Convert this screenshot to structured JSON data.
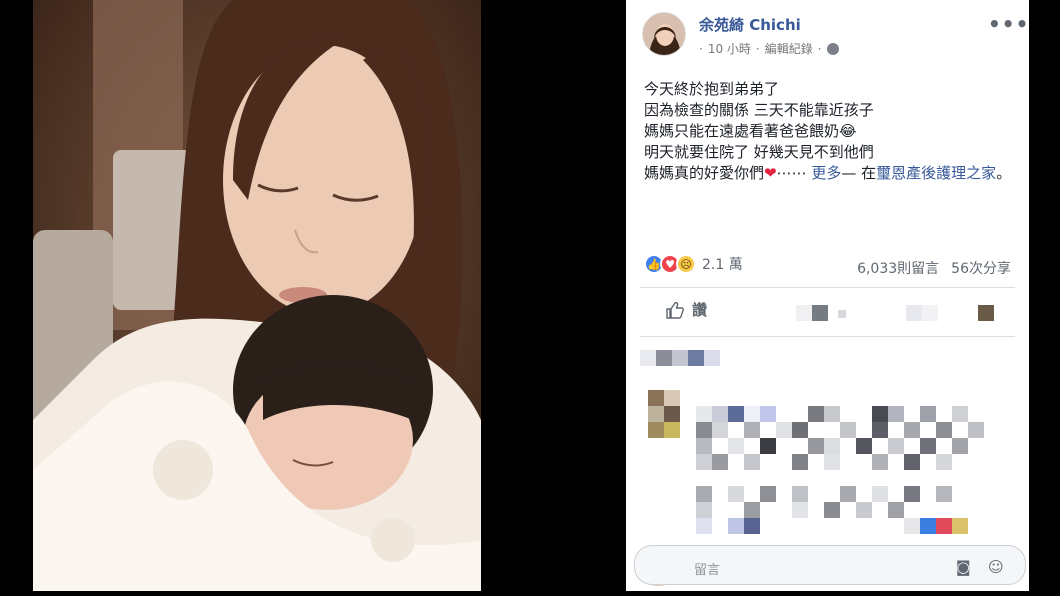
{
  "post": {
    "author": "余苑綺 Chichi",
    "time": "10 小時",
    "separator": "·",
    "edit_history": "編輯紀錄",
    "lines": [
      "今天終於抱到弟弟了",
      "因為檢查的關係 三天不能靠近孩子",
      "媽媽只能在遠處看著爸爸餵奶😂",
      "明天就要住院了 好幾天見不到他們"
    ],
    "last_line_start": "媽媽真的好愛你們",
    "heart": "❤",
    "ellipsis": "⋯⋯",
    "see_more": "更多",
    "location_prefix": "— 在",
    "location": "璽恩產後護理之家",
    "end_punct": "。"
  },
  "reactions": {
    "count": "2.1 萬",
    "comments": "6,033則留言",
    "shares": "56次分享"
  },
  "actions": {
    "like_label": "讚"
  },
  "comment_bar": {
    "placeholder": "留言"
  },
  "icons": {
    "more": "more-icon",
    "globe": "globe-icon",
    "like": "thumbs-up-icon",
    "camera": "camera-icon",
    "sticker": "sticker-icon"
  },
  "colors": {
    "link": "#385898",
    "like": "#3f7ff0",
    "love": "#f0424c"
  }
}
